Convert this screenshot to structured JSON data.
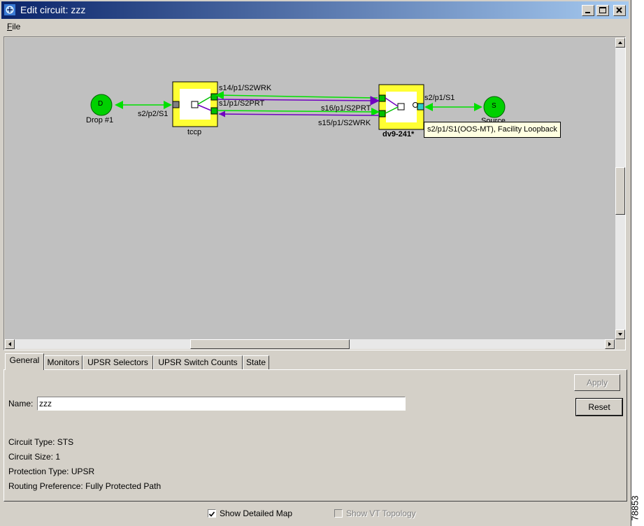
{
  "window": {
    "title": "Edit circuit: zzz",
    "icon": "app-icon",
    "controls": {
      "minimize": "minimize-icon",
      "maximize": "maximize-icon",
      "close": "close-icon"
    }
  },
  "menu": {
    "file": "File"
  },
  "map": {
    "nodes": {
      "drop": {
        "letter": "D",
        "label": "Drop #1"
      },
      "tccp": {
        "label": "tccp"
      },
      "dv9": {
        "label": "dv9-241*"
      },
      "source": {
        "letter": "S",
        "label": "Source"
      }
    },
    "links": {
      "drop_port": "s2/p2/S1",
      "span1": "s14/p1/S2WRK",
      "span2": "s1/p1/S2PRT",
      "span3": "s16/p1/S2PRT",
      "span4": "s15/p1/S2WRK",
      "source_port": "s2/p1/S1"
    },
    "tooltip": "s2/p1/S1(OOS-MT), Facility Loopback",
    "colors": {
      "working": "#00e000",
      "protect": "#7000c0",
      "node": "#00d000",
      "card": "#ffff33"
    }
  },
  "tabs": [
    "General",
    "Monitors",
    "UPSR Selectors",
    "UPSR Switch Counts",
    "State"
  ],
  "general": {
    "apply_label": "Apply",
    "reset_label": "Reset",
    "name_label": "Name:",
    "name_value": "zzz",
    "circuit_type": "Circuit Type:  STS",
    "circuit_size": "Circuit Size: 1",
    "protection_type": "Protection Type:  UPSR",
    "routing_preference": "Routing Preference: Fully Protected Path"
  },
  "footer": {
    "show_detailed_map": "Show Detailed Map",
    "show_detailed_map_checked": true,
    "show_vt_topology": "Show VT Topology",
    "show_vt_topology_checked": false
  },
  "side_code": "78853"
}
